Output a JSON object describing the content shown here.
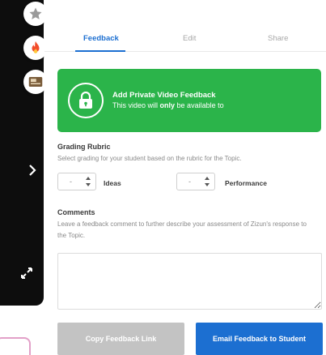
{
  "sidebar": {
    "icons": [
      "star-icon",
      "fire-icon",
      "video-card-icon"
    ],
    "nav_icons": [
      "chevron-right-icon",
      "expand-icon"
    ],
    "colors": {
      "rail": "#0d0d0d",
      "star": "#9a9a9a",
      "fire": "#f24c2a"
    }
  },
  "tabs": [
    {
      "label": "Feedback",
      "active": true
    },
    {
      "label": "Edit",
      "active": false
    },
    {
      "label": "Share",
      "active": false
    }
  ],
  "banner": {
    "title": "Add Private Video Feedback",
    "subtitle_prefix": "This video will ",
    "subtitle_bold": "only",
    "subtitle_suffix": " be available to",
    "icon": "lock-icon",
    "color": "#2bb44a"
  },
  "grading": {
    "title": "Grading Rubric",
    "description": "Select grading for your student based on the rubric for the Topic.",
    "criteria": [
      {
        "value": "-",
        "label": "Ideas"
      },
      {
        "value": "-",
        "label": "Performance"
      }
    ]
  },
  "comments": {
    "title": "Comments",
    "description": "Leave a feedback comment to further describe your assessment of Zizun's response to the Topic.",
    "value": ""
  },
  "buttons": {
    "copy_label": "Copy Feedback Link",
    "email_label": "Email Feedback to Student",
    "colors": {
      "copy": "#c3c3c3",
      "email": "#1c6fd1"
    }
  }
}
